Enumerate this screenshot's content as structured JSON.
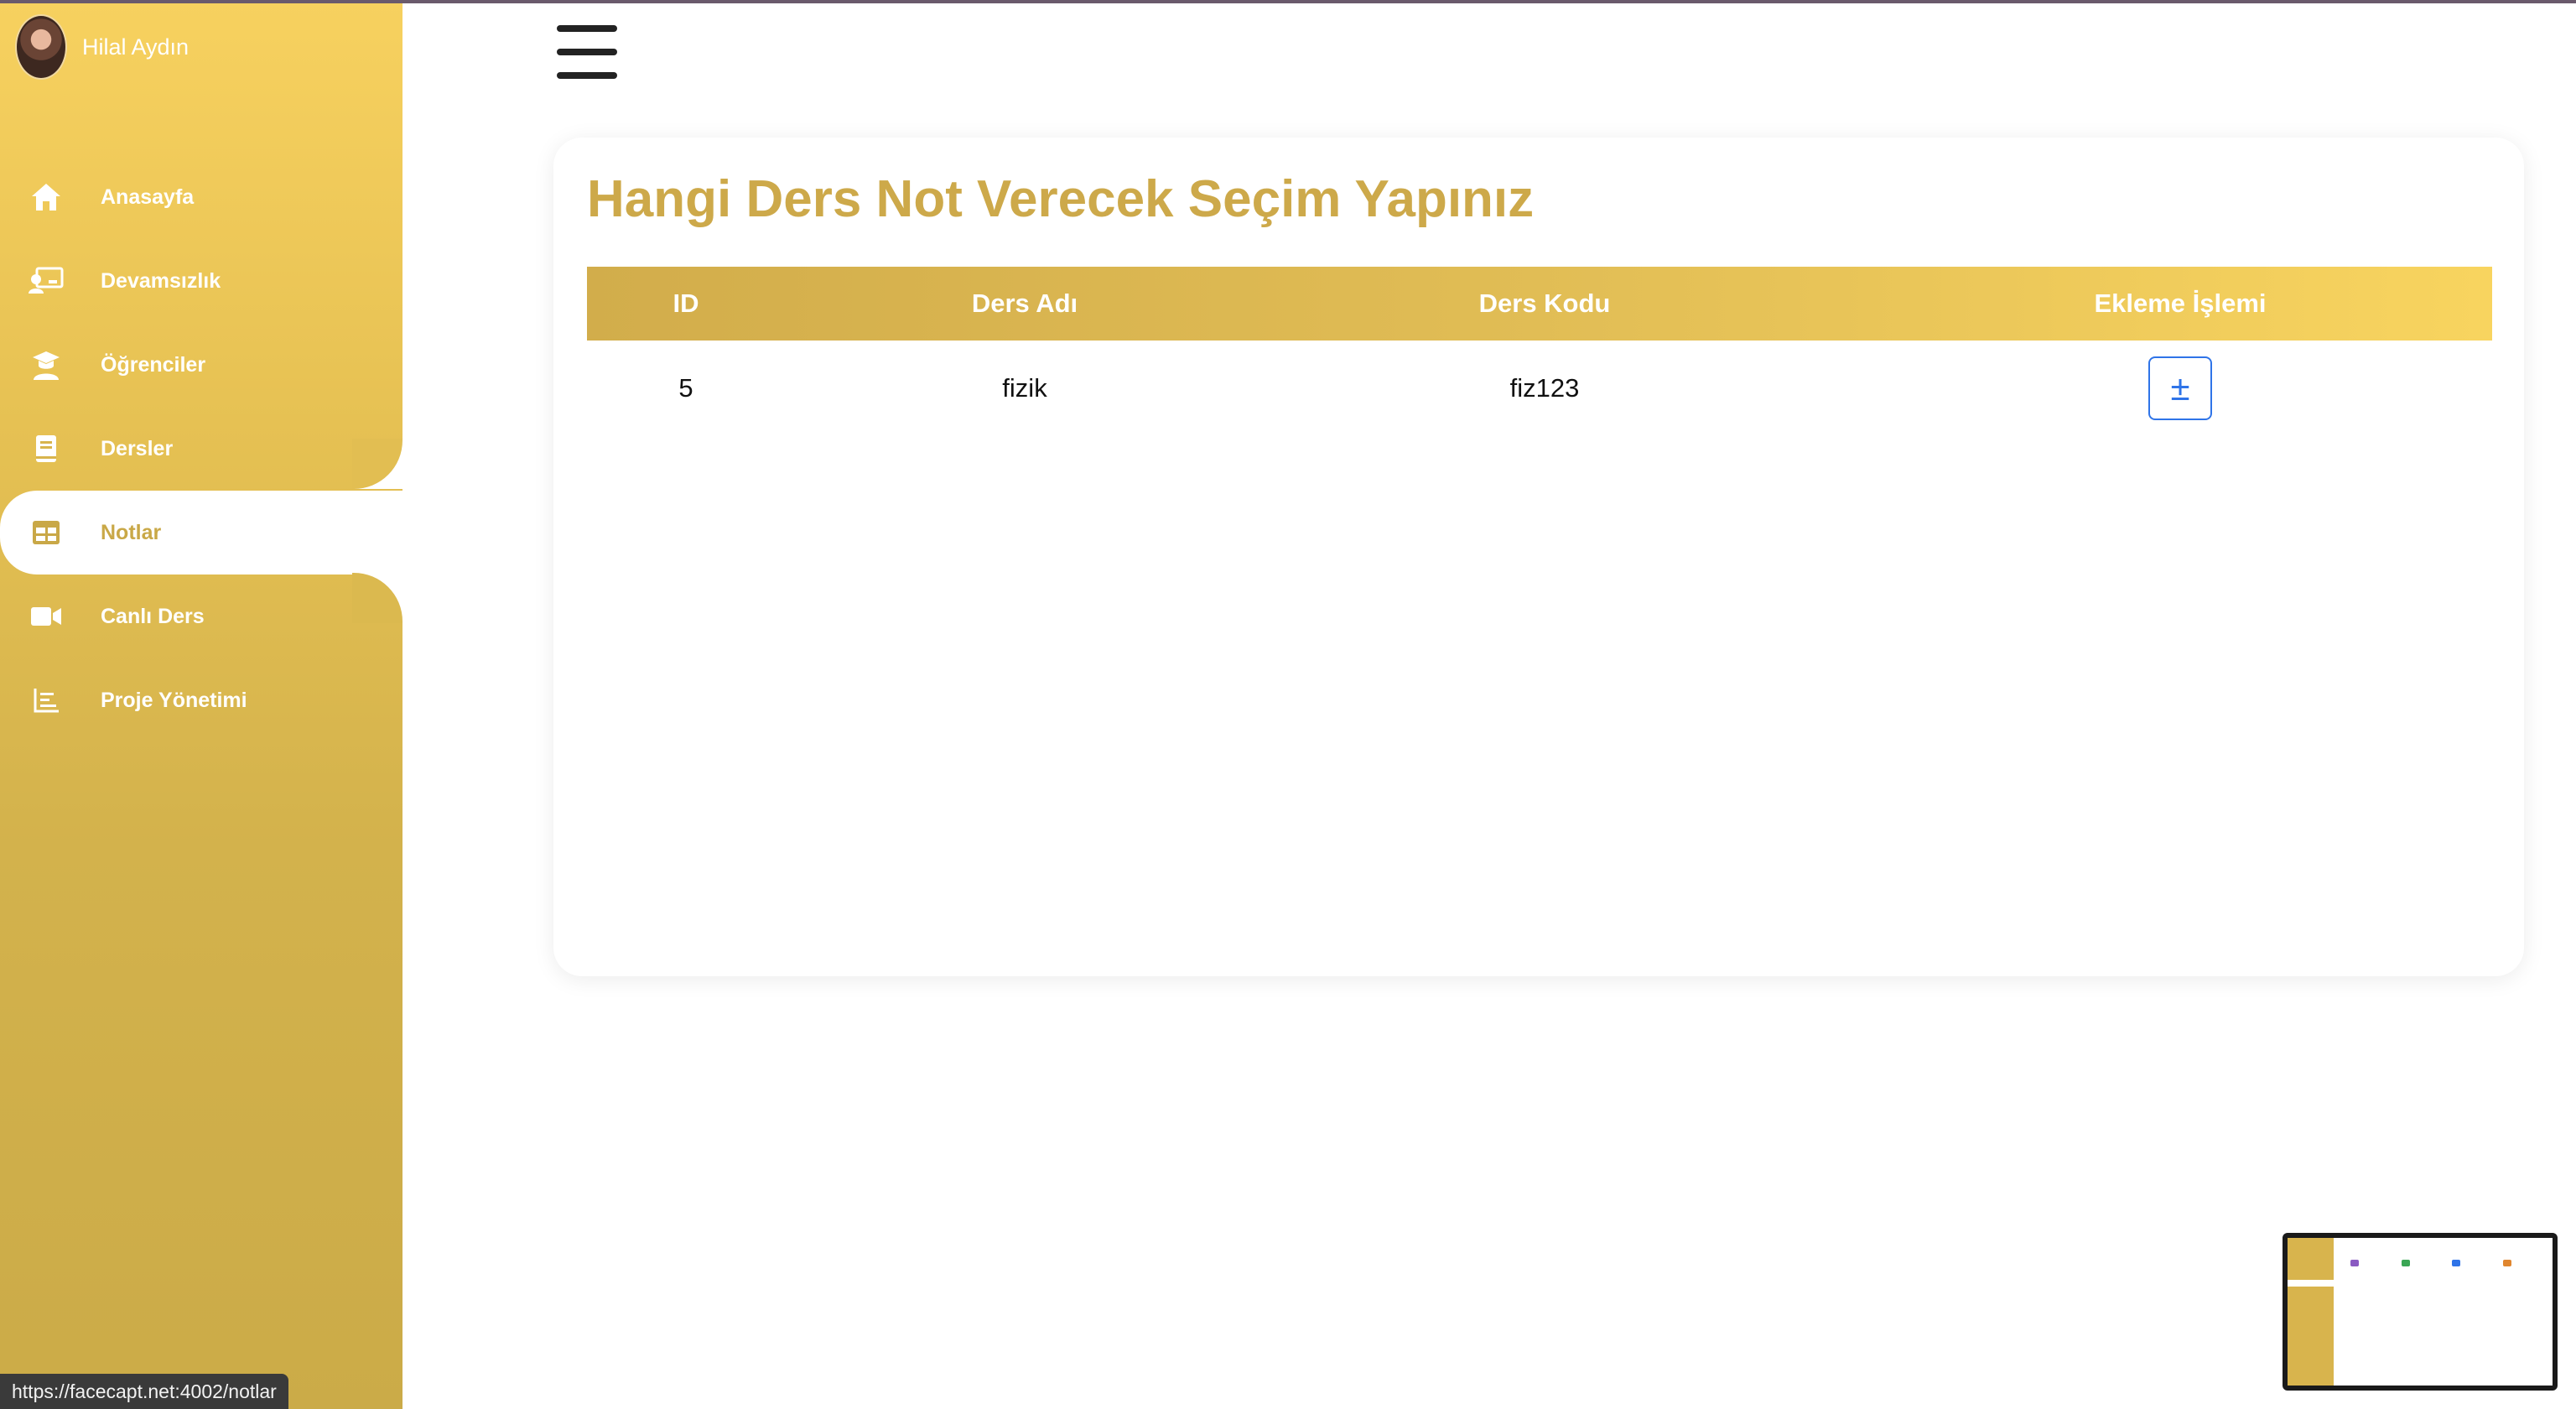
{
  "user": {
    "name": "Hilal Aydın"
  },
  "sidebar": {
    "items": [
      {
        "label": "Anasayfa",
        "icon": "home-icon"
      },
      {
        "label": "Devamsızlık",
        "icon": "attendance-icon"
      },
      {
        "label": "Öğrenciler",
        "icon": "graduate-icon"
      },
      {
        "label": "Dersler",
        "icon": "book-icon"
      },
      {
        "label": "Notlar",
        "icon": "table-icon",
        "active": true
      },
      {
        "label": "Canlı Ders",
        "icon": "video-icon"
      },
      {
        "label": "Proje Yönetimi",
        "icon": "chart-icon"
      }
    ]
  },
  "main": {
    "title": "Hangi Ders Not Verecek Seçim Yapınız",
    "table": {
      "headers": [
        "ID",
        "Ders Adı",
        "Ders Kodu",
        "Ekleme İşlemi"
      ],
      "rows": [
        {
          "id": "5",
          "name": "fizik",
          "code": "fiz123",
          "action": "±"
        }
      ]
    }
  },
  "status_bar": {
    "url": "https://facecapt.net:4002/notlar"
  },
  "colors": {
    "accent": "#cda94a",
    "sidebar_top": "#f7d15f",
    "sidebar_bottom": "#cbab48",
    "button": "#2f74e8"
  }
}
